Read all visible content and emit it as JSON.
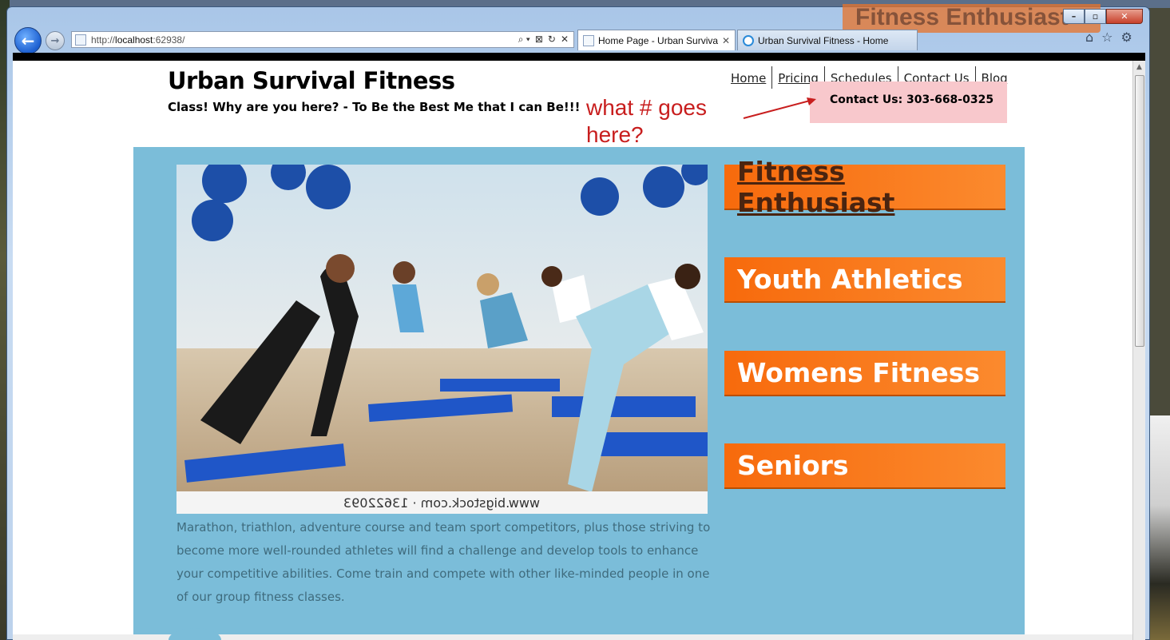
{
  "window": {
    "ghost_title": "Fitness Enthusiast",
    "controls": {
      "minimize": "–",
      "maximize": "▫",
      "close": "✕"
    }
  },
  "browser": {
    "url_prefix": "http://",
    "url_host": "localhost",
    "url_suffix": ":62938/",
    "tabs": [
      {
        "title": "Home Page - Urban Surviva...",
        "active": true,
        "close": "✕"
      },
      {
        "title": "Urban Survival Fitness - Home",
        "active": false
      }
    ],
    "address_tools": [
      "⌕ ▾",
      "⊠",
      "↻",
      "✕"
    ]
  },
  "site": {
    "title": "Urban Survival Fitness",
    "tagline": "Class! Why are you here? - To Be the Best Me that I can Be!!!",
    "menu": [
      "Home",
      "Pricing",
      "Schedules",
      "Contact Us",
      "Blog"
    ],
    "contact": "Contact Us: 303-668-0325",
    "annotation": "what # goes here?",
    "hero_watermark": "www.bigstock.com · 13622093",
    "blurb": "Marathon, triathlon, adventure course and team sport competitors, plus those striving to become more well-rounded athletes will find a challenge and develop tools to enhance your competitive abilities. Come train and compete with other like-minded people in one of our group fitness classes.",
    "programs": [
      "Fitness Enthusiast",
      "Youth Athletics",
      "Womens Fitness",
      "Seniors"
    ]
  },
  "colors": {
    "featured_bg": "#7bbdd9",
    "program_orange": "#f76a0c",
    "contact_pink": "#f8c8cc",
    "annotation_red": "#c81e1e"
  }
}
